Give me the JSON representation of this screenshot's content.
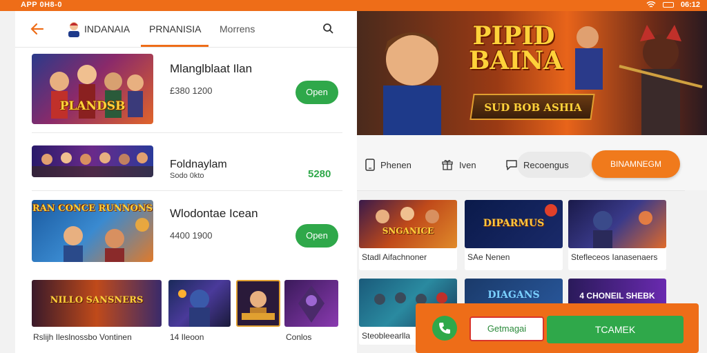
{
  "status_bar": {
    "left_text": "APP 0H8-0",
    "time": "06:12"
  },
  "header": {
    "title": "INDANAIA",
    "tabs": [
      {
        "label": "PRNANISIA",
        "active": true
      },
      {
        "label": "Morrens",
        "active": false
      }
    ]
  },
  "list": [
    {
      "title": "Mlanglblaat Ilan",
      "sub": "£380 1200",
      "thumb_text": "PLANDSB",
      "action": "Open"
    },
    {
      "title": "Foldnaylam",
      "sub": "Sodo 0kto",
      "thumb_text": "",
      "price": "5280"
    },
    {
      "title": "Wlodontae Icean",
      "sub": "4400 1900",
      "thumb_text": "RAN CONCE RUNNONS",
      "action": "Open"
    }
  ],
  "bottom_tiles": [
    {
      "text": "NILLO SANSNERS"
    },
    {
      "text": ""
    },
    {
      "text": ""
    },
    {
      "text": ""
    }
  ],
  "bottom_labels": [
    "Rslijh Ileslnossbo Vontinen",
    "14 Ileoon",
    "Conlos"
  ],
  "banner": {
    "title": "PIPID BAINA",
    "subtitle": "SUD BOB ASHIA"
  },
  "filters": [
    {
      "icon": "phone-icon",
      "label": "Phenen"
    },
    {
      "icon": "gift-icon",
      "label": "Iven"
    },
    {
      "icon": "chat-icon",
      "label": "Recoengus"
    }
  ],
  "cta_label": "BINAMNEGM",
  "grid": [
    {
      "label": "Stadl Aifachnoner",
      "text": "SNGANICE"
    },
    {
      "label": "SAe Nenen",
      "text": "DIPARMUS"
    },
    {
      "label": "Stefleceos Ianasenaers",
      "text": ""
    },
    {
      "label": "Steobleearlla",
      "text": ""
    },
    {
      "label": "",
      "text": "DIAGANS"
    },
    {
      "label": "",
      "text": "4 CHONEIL SHEBK"
    }
  ],
  "action_bar": {
    "input_value": "Getmagai",
    "button_label": "TCAMEK"
  },
  "colors": {
    "accent": "#ee6d18",
    "green": "#2fa84a"
  }
}
